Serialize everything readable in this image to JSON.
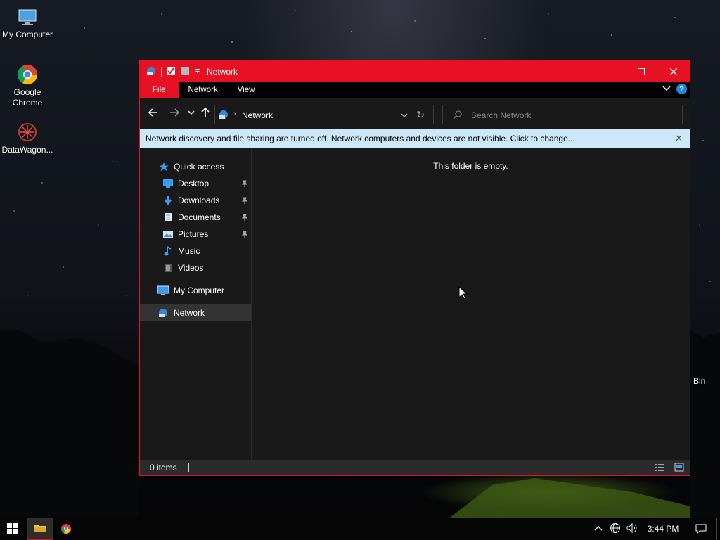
{
  "desktop": {
    "icons": [
      {
        "label": "My Computer"
      },
      {
        "label": "Google Chrome"
      },
      {
        "label": "DataWagon..."
      }
    ],
    "recycle_bin_partial_label": "Bin"
  },
  "window": {
    "title": "Network",
    "accent_color": "#e81123",
    "ribbon_tabs": [
      "File",
      "Network",
      "View"
    ],
    "address": {
      "breadcrumb": "Network"
    },
    "search": {
      "placeholder": "Search Network"
    },
    "infobar": {
      "message": "Network discovery and file sharing are turned off. Network computers and devices are not visible. Click to change..."
    },
    "sidebar": {
      "quick_access": "Quick access",
      "items": [
        {
          "label": "Desktop",
          "icon": "desktop-icon",
          "pinned": true
        },
        {
          "label": "Downloads",
          "icon": "downloads-icon",
          "pinned": true
        },
        {
          "label": "Documents",
          "icon": "documents-icon",
          "pinned": true
        },
        {
          "label": "Pictures",
          "icon": "pictures-icon",
          "pinned": true
        },
        {
          "label": "Music",
          "icon": "music-icon",
          "pinned": false
        },
        {
          "label": "Videos",
          "icon": "videos-icon",
          "pinned": false
        }
      ],
      "my_computer": "My Computer",
      "network": "Network"
    },
    "main": {
      "empty_text": "This folder is empty."
    },
    "status": {
      "items_text": "0 items"
    }
  },
  "taskbar": {
    "clock": "3:44 PM"
  }
}
